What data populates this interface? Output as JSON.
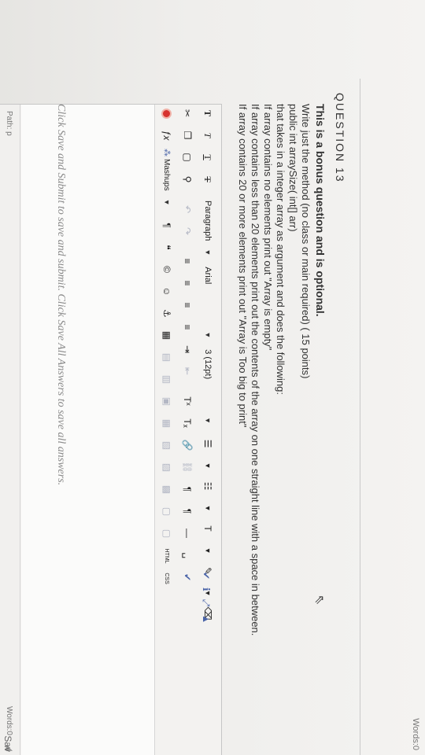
{
  "top_word_count": "Words:0",
  "question": {
    "title": "QUESTION 13",
    "lines": [
      "This is a bonus question and is optional.",
      "Write just the method (no class or main required) ( 15 points)",
      "public int arraySize( int[] arr)",
      "that takes in a integer array as argument and does the following:",
      "If array contains no elements print out \"Array is empty\"",
      "If array contains less than 20 elements print out the contents of the array on one straight line with a space in between.",
      "If array contains 20 or more elements print out \"Array is Too big to print\""
    ]
  },
  "toolbar": {
    "paragraph": "Paragraph",
    "font": "Arial",
    "size": "3 (12pt)",
    "mashups": "Mashups",
    "html": "HTML",
    "css": "CSS"
  },
  "status": {
    "path": "Path: p",
    "words": "Words:0"
  },
  "save_note": "Click Save and Submit to save and submit. Click Save All Answers to save all answers.",
  "corner_button": "Sav"
}
